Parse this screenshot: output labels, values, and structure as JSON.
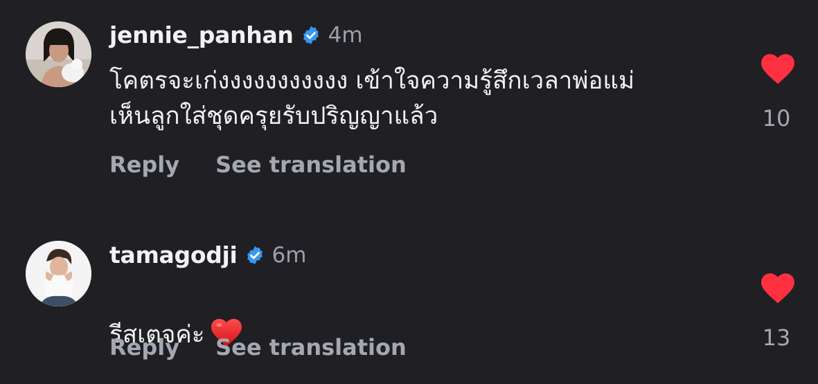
{
  "comments": [
    {
      "username": "jennie_panhan",
      "time": "4m",
      "text": "โคตรจะเก่งงงงงงงงงงง เข้าใจความรู้สึกเวลาพ่อแม่\nเห็นลูกใส่ชุดครุยรับปริญญาแล้ว",
      "like_count": "10",
      "reply_label": "Reply",
      "translate_label": "See translation",
      "verified_icon": "verified-badge-icon",
      "like_icon": "heart-filled-icon"
    },
    {
      "username": "tamagodji",
      "time": "6m",
      "text": "รีสเตจค่ะ",
      "like_count": "13",
      "reply_label": "Reply",
      "translate_label": "See translation",
      "verified_icon": "verified-badge-icon",
      "like_icon": "heart-filled-icon"
    }
  ],
  "colors": {
    "background": "#1f1f24",
    "like_red": "#ff3040",
    "verified_blue": "#3897f0",
    "secondary_text": "#a4a8b0"
  }
}
